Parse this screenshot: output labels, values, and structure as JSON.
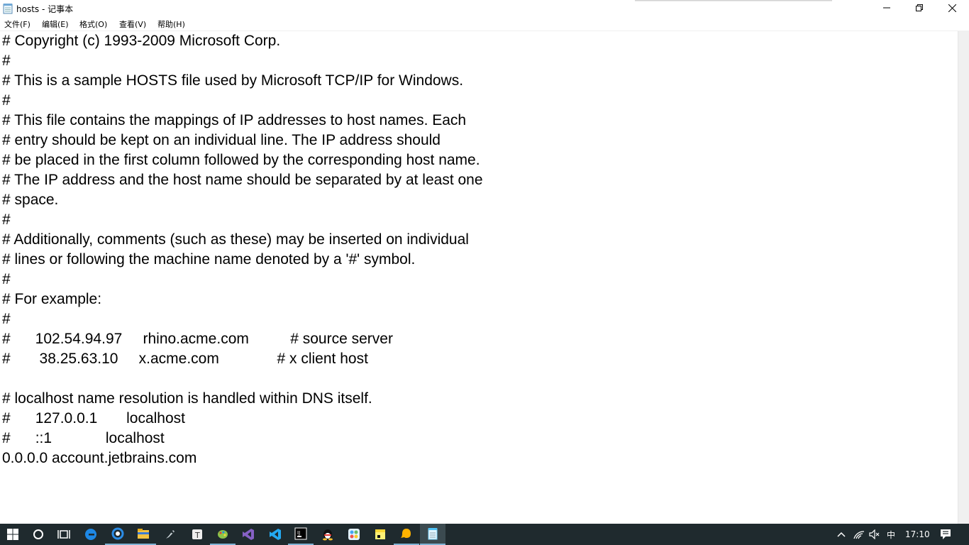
{
  "window": {
    "title": "hosts - 记事本",
    "minimize_glyph": "—",
    "restore_glyph": "❐",
    "close_glyph": "✕"
  },
  "menu": [
    {
      "label": "文件(F)"
    },
    {
      "label": "编辑(E)"
    },
    {
      "label": "格式(O)"
    },
    {
      "label": "查看(V)"
    },
    {
      "label": "帮助(H)"
    }
  ],
  "document": {
    "lines": [
      "# Copyright (c) 1993-2009 Microsoft Corp.",
      "#",
      "# This is a sample HOSTS file used by Microsoft TCP/IP for Windows.",
      "#",
      "# This file contains the mappings of IP addresses to host names. Each",
      "# entry should be kept on an individual line. The IP address should",
      "# be placed in the first column followed by the corresponding host name.",
      "# The IP address and the host name should be separated by at least one",
      "# space.",
      "#",
      "# Additionally, comments (such as these) may be inserted on individual",
      "# lines or following the machine name denoted by a '#' symbol.",
      "#",
      "# For example:",
      "#",
      "#      102.54.94.97     rhino.acme.com          # source server",
      "#       38.25.63.10     x.acme.com              # x client host",
      "",
      "# localhost name resolution is handled within DNS itself.",
      "#\t127.0.0.1       localhost",
      "#\t::1             localhost",
      "0.0.0.0 account.jetbrains.com"
    ]
  },
  "taskbar": {
    "background": "#1f2a2e",
    "apps": [
      {
        "name": "start-button",
        "icon": "windows-icon"
      },
      {
        "name": "search-button",
        "icon": "cortana-circle-icon"
      },
      {
        "name": "task-view-button",
        "icon": "task-view-icon"
      },
      {
        "name": "edge-app",
        "icon": "edge-icon"
      },
      {
        "name": "browser-app",
        "icon": "browser-icon"
      },
      {
        "name": "file-explorer-app",
        "icon": "folder-icon"
      },
      {
        "name": "rocket-app",
        "icon": "rocket-icon"
      },
      {
        "name": "typora-app",
        "icon": "typora-icon"
      },
      {
        "name": "paint-app",
        "icon": "paint-icon"
      },
      {
        "name": "visual-studio-app",
        "icon": "visual-studio-icon"
      },
      {
        "name": "vscode-app",
        "icon": "vscode-icon"
      },
      {
        "name": "intellij-app",
        "icon": "intellij-icon"
      },
      {
        "name": "qq-app",
        "icon": "qq-penguin-icon"
      },
      {
        "name": "network-app",
        "icon": "network-icon"
      },
      {
        "name": "sticky-notes-app",
        "icon": "sticky-notes-icon"
      },
      {
        "name": "qq-chat-app",
        "icon": "qq-chat-icon"
      },
      {
        "name": "notepad-app",
        "icon": "notepad-icon"
      }
    ],
    "tray": {
      "ime": "中",
      "time": "17:10"
    }
  }
}
